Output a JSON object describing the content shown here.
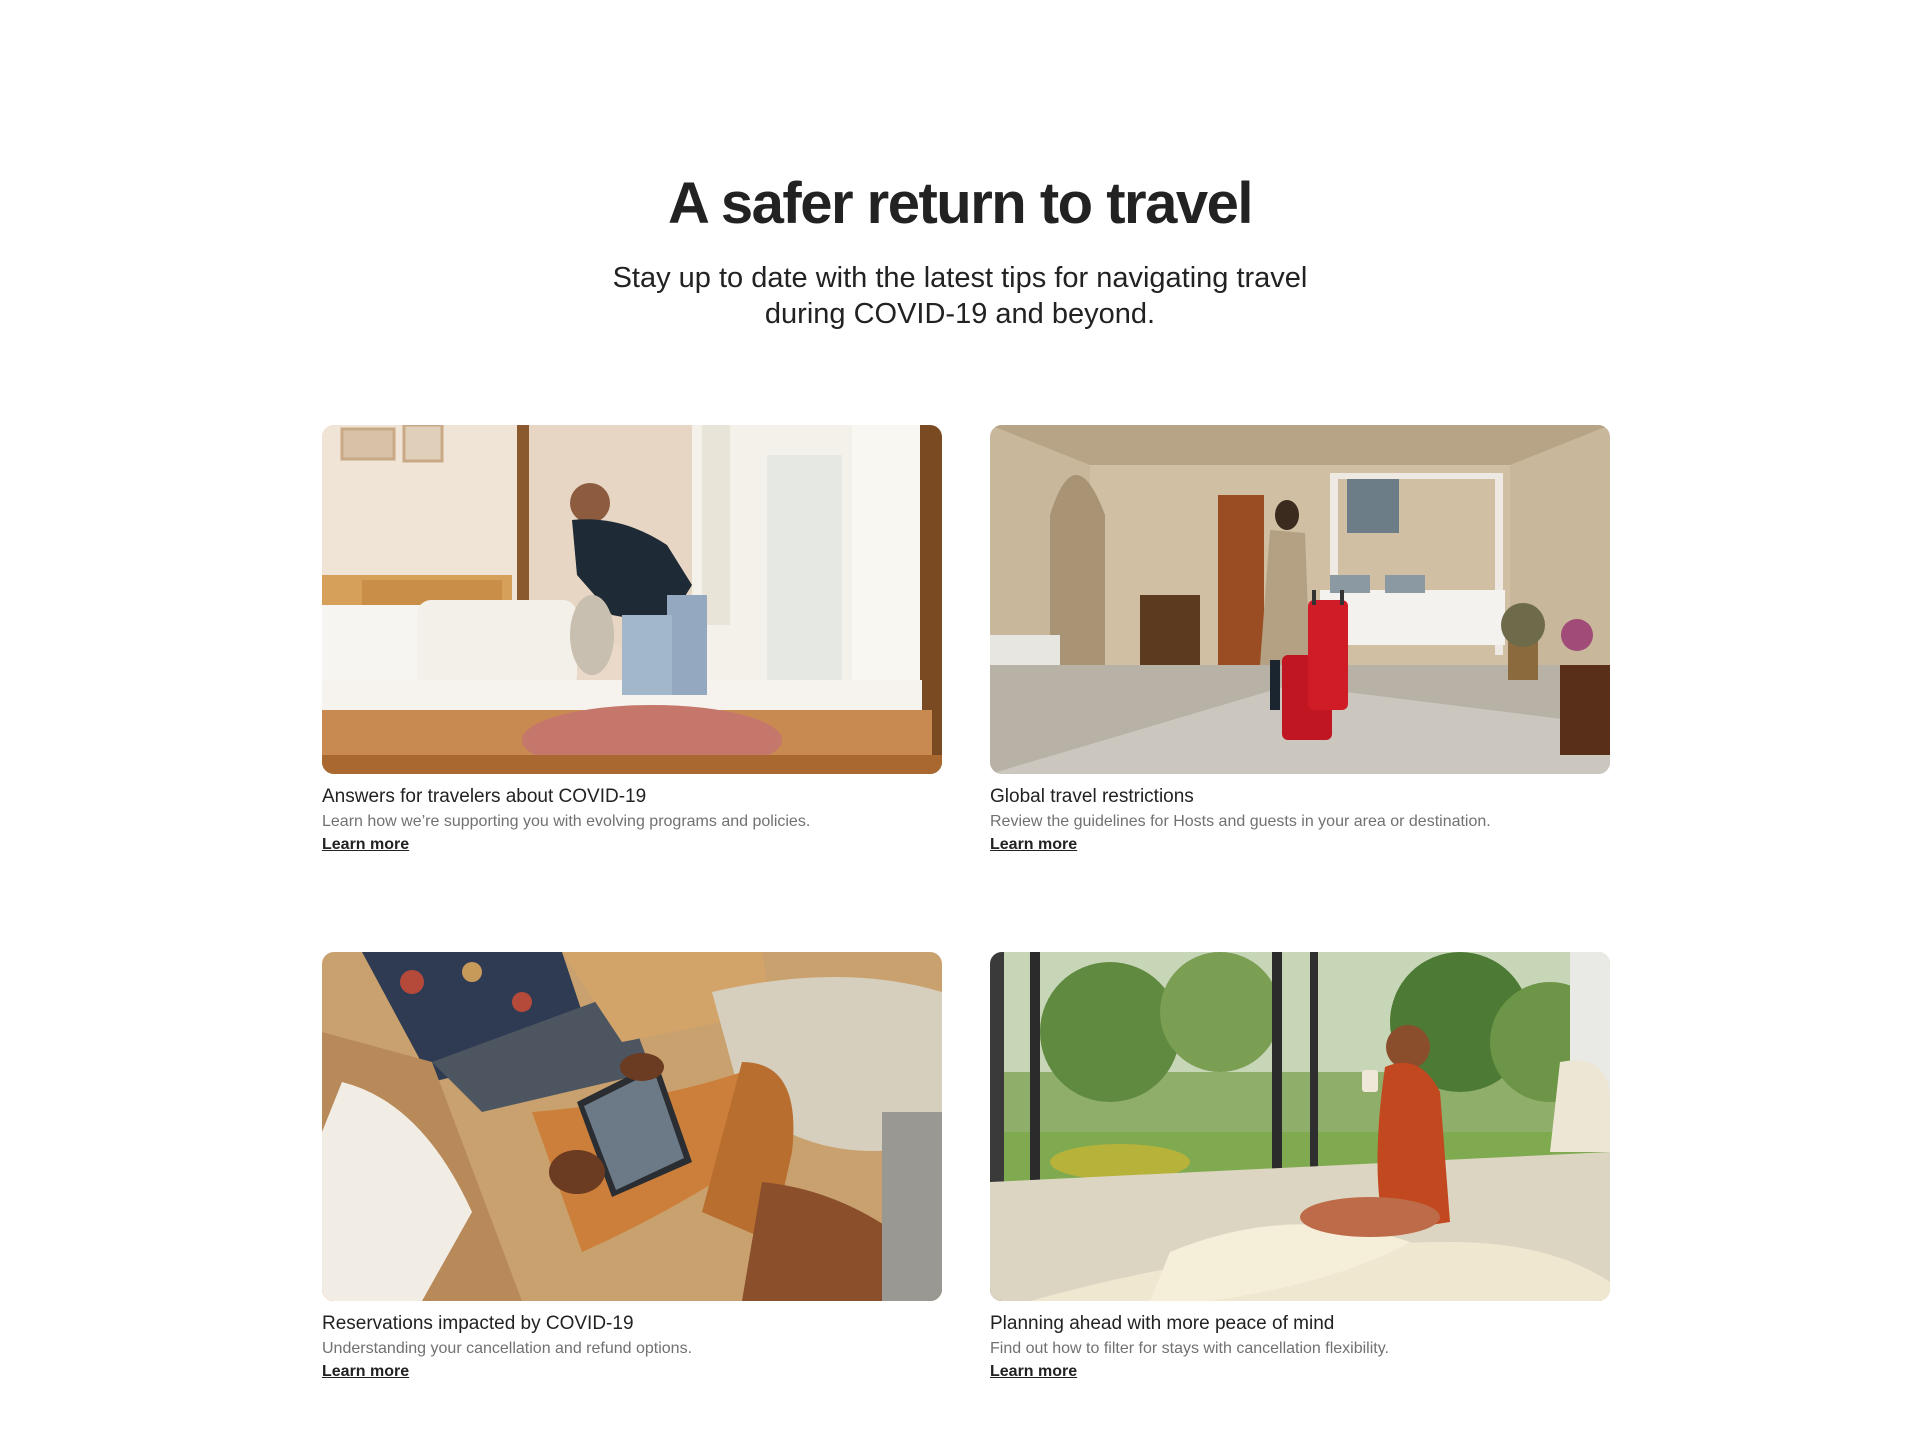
{
  "hero": {
    "title": "A safer return to travel",
    "subtitle": "Stay up to date with the latest tips for navigating travel during COVID-19 and beyond."
  },
  "cards": [
    {
      "title": "Answers for travelers about COVID-19",
      "description": "Learn how we’re supporting you with evolving programs and policies.",
      "link": "Learn more",
      "image": "host-making-bed-photo"
    },
    {
      "title": "Global travel restrictions",
      "description": "Review the guidelines for Hosts and guests in your area or destination.",
      "link": "Learn more",
      "image": "traveler-with-red-suitcases-photo"
    },
    {
      "title": "Reservations impacted by COVID-19",
      "description": "Understanding your cancellation and refund options.",
      "link": "Learn more",
      "image": "person-using-phone-on-sofa-photo"
    },
    {
      "title": "Planning ahead with more peace of mind",
      "description": "Find out how to filter for stays with cancellation flexibility.",
      "link": "Learn more",
      "image": "woman-on-bed-garden-view-photo"
    }
  ]
}
